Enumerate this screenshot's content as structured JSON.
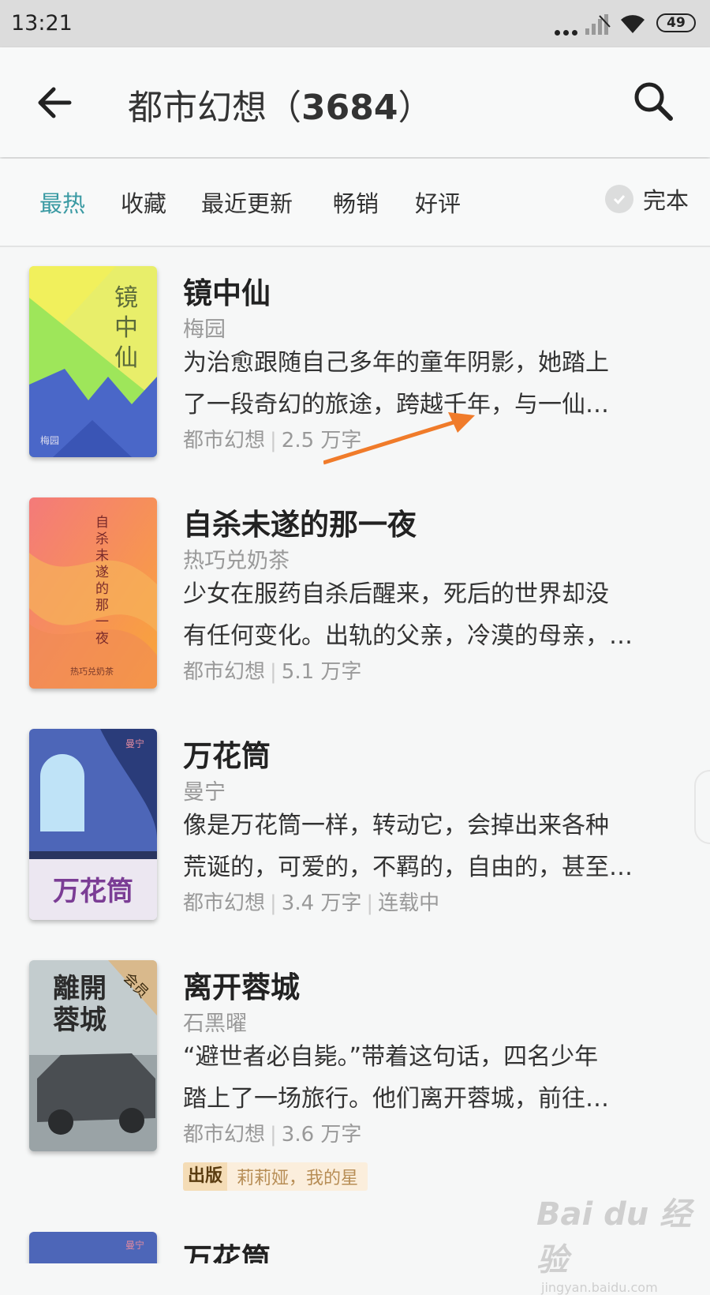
{
  "status_bar": {
    "time": "13:21",
    "battery": "49"
  },
  "header": {
    "title": "都市幻想",
    "count": "3684"
  },
  "filters": {
    "tabs": [
      "最热",
      "收藏",
      "最近更新",
      "畅销",
      "好评"
    ],
    "complete_label": "完本"
  },
  "books": [
    {
      "title": "镜中仙",
      "author": "梅园",
      "desc_line1": "为治愈跟随自己多年的童年阴影，她踏上",
      "desc_line2": "了一段奇幻的旅途，跨越千年，与一仙…",
      "genre": "都市幻想",
      "words": "2.5 万字",
      "cover_title": "镜中仙",
      "cover_author": "梅园"
    },
    {
      "title": "自杀未遂的那一夜",
      "author": "热巧兑奶茶",
      "desc_line1": "少女在服药自杀后醒来，死后的世界却没",
      "desc_line2": "有任何变化。出轨的父亲，冷漠的母亲，…",
      "genre": "都市幻想",
      "words": "5.1 万字",
      "cover_title": "自杀未遂的那一夜",
      "cover_author": "热巧兑奶茶"
    },
    {
      "title": "万花筒",
      "author": "曼宁",
      "desc_line1": "像是万花筒一样，转动它，会掉出来各种",
      "desc_line2": "荒诞的，可爱的，不羁的，自由的，甚至…",
      "genre": "都市幻想",
      "words": "3.4 万字",
      "status": "连载中",
      "cover_title": "万花筒",
      "cover_author": "曼宁"
    },
    {
      "title": "离开蓉城",
      "author": "石黑曜",
      "desc_line1": "“避世者必自毙。”带着这句话，四名少年",
      "desc_line2": "踏上了一场旅行。他们离开蓉城，前往…",
      "genre": "都市幻想",
      "words": "3.6 万字",
      "cover_title": "離開蓉城",
      "member_badge": "会员",
      "pub_badge": "出版",
      "pub_text": "莉莉娅，我的星"
    },
    {
      "title": "万花筒",
      "cover_author": "曼宁"
    }
  ],
  "watermark": {
    "brand": "Bai du 经验",
    "url": "jingyan.baidu.com"
  },
  "colors": {
    "accent": "#3a9aa3",
    "arrow": "#f07b2a"
  }
}
